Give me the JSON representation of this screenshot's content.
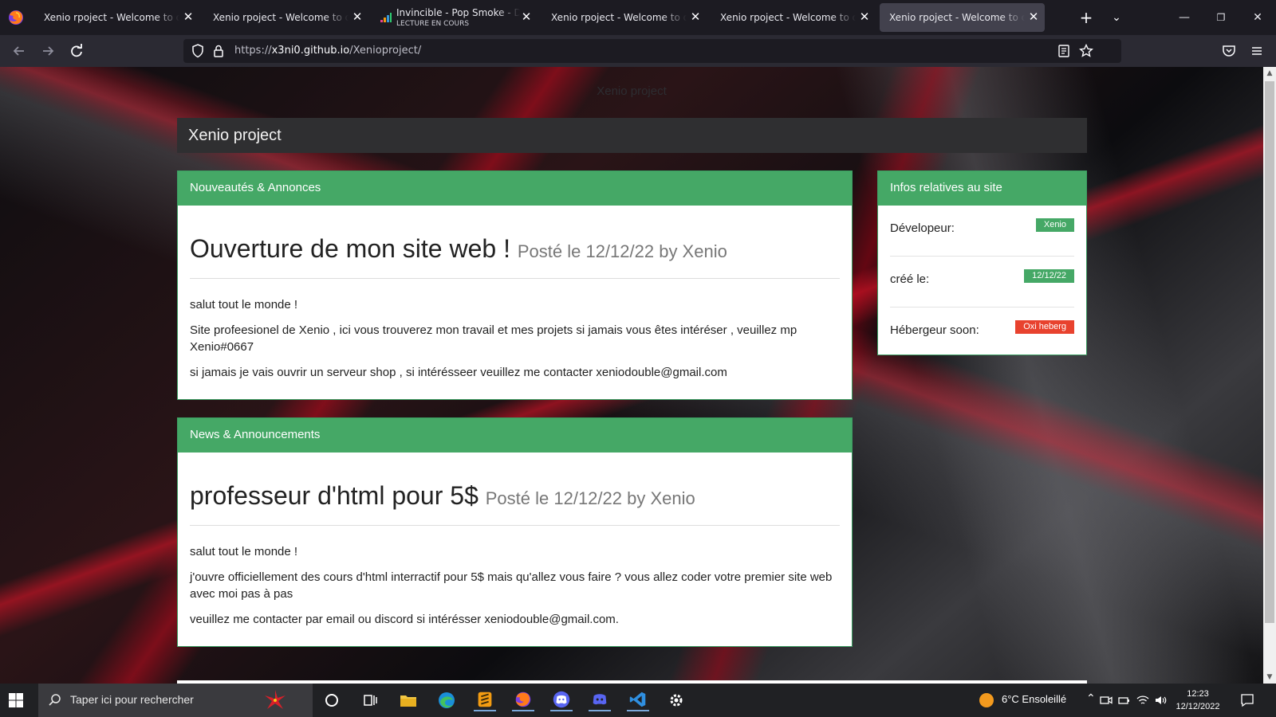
{
  "browser": {
    "tabs": [
      {
        "title": "Xenio rpoject - Welcome to our site",
        "active": false
      },
      {
        "title": "Xenio rpoject - Welcome to our site",
        "active": false
      },
      {
        "title": "Invincible - Pop Smoke - Deezer",
        "subtitle": "LECTURE EN COURS",
        "active": false
      },
      {
        "title": "Xenio rpoject - Welcome to our site",
        "active": false
      },
      {
        "title": "Xenio rpoject - Welcome to our site",
        "active": false
      },
      {
        "title": "Xenio rpoject - Welcome to our site",
        "active": true
      }
    ],
    "url_prefix": "https://",
    "url_host": "x3ni0.github.io",
    "url_path": "/Xenioproject/"
  },
  "page": {
    "faint_title": "Xenio project",
    "header_title": "Xenio project",
    "panels": [
      {
        "heading": "Nouveautés & Annonces",
        "post_title": "Ouverture de mon site web !",
        "post_meta": "Posté le 12/12/22 by Xenio",
        "paragraphs": [
          "salut tout le monde !",
          "Site profeesionel de Xenio , ici vous trouverez mon travail et mes projets si jamais vous êtes intéréser , veuillez mp Xenio#0667",
          "si jamais je vais ouvrir un serveur shop , si intérésseer veuillez me contacter xeniodouble@gmail.com"
        ]
      },
      {
        "heading": "News & Announcements",
        "post_title": "professeur d'html pour 5$",
        "post_meta": "Posté le 12/12/22 by Xenio",
        "paragraphs": [
          "salut tout le monde !",
          "j'ouvre officiellement des cours d'html interractif pour 5$ mais qu'allez vous faire ? vous allez coder votre premier site web avec moi pas à pas",
          "veuillez me contacter par email ou discord si intérésser xeniodouble@gmail.com."
        ]
      }
    ],
    "info": {
      "heading": "Infos relatives au site",
      "rows": [
        {
          "label": "Dévelopeur:",
          "badge": "Xenio",
          "badge_color": "#45a866"
        },
        {
          "label": "créé le:",
          "badge": "12/12/22",
          "badge_color": "#45a866"
        },
        {
          "label": "Hébergeur soon:",
          "badge": "Oxi heberg",
          "badge_color": "#e8422e"
        }
      ]
    }
  },
  "taskbar": {
    "search_placeholder": "Taper ici pour rechercher",
    "weather": "6°C  Ensoleillé",
    "time": "12:23",
    "date": "12/12/2022"
  }
}
